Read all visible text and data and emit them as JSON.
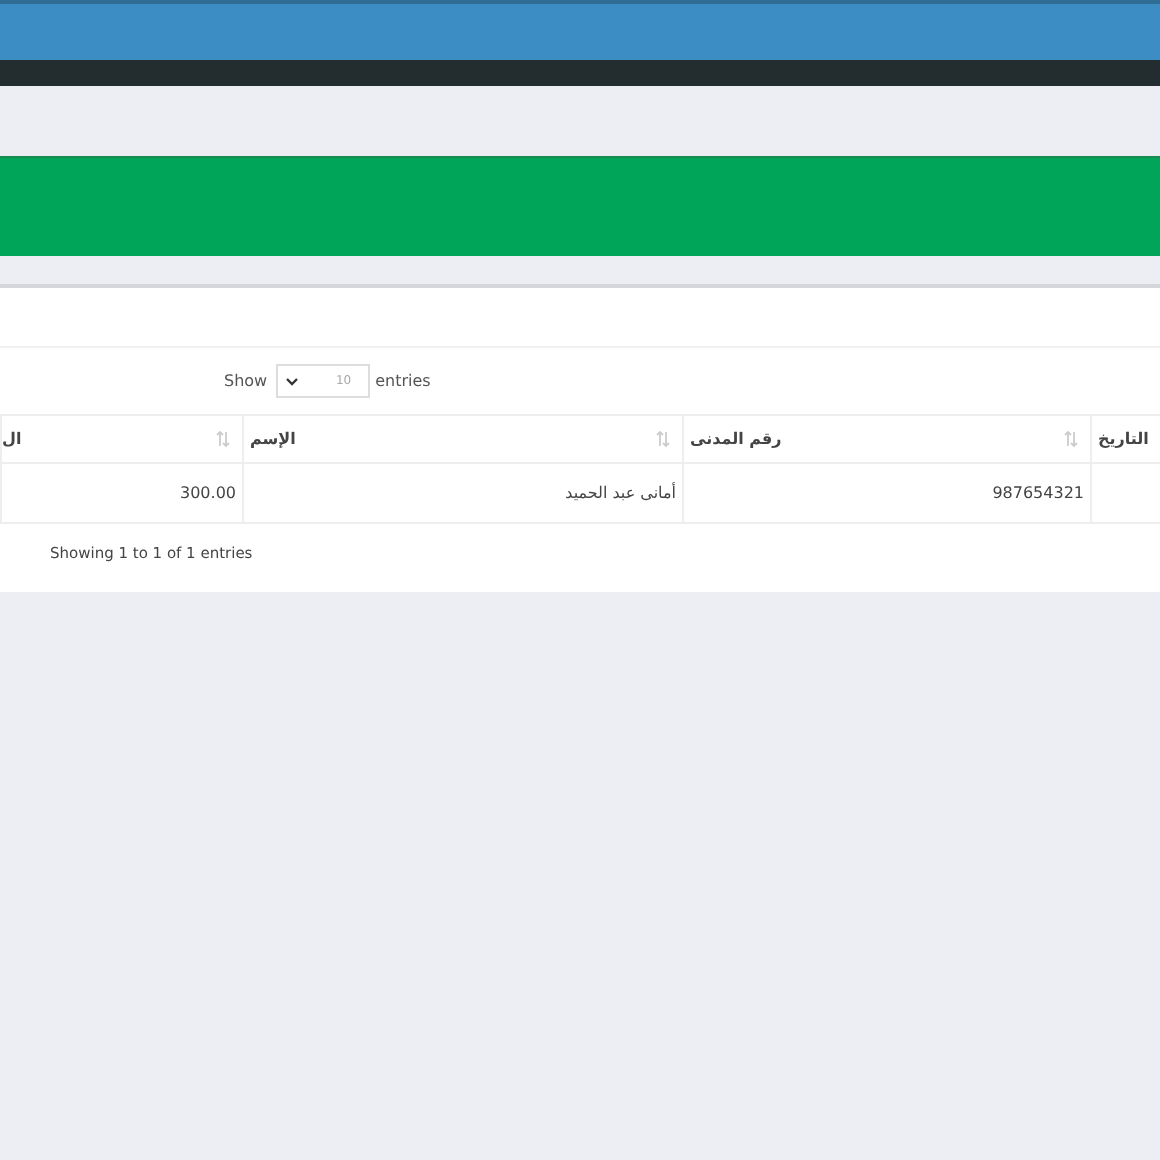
{
  "length_control": {
    "before": "Show",
    "value": "10",
    "after": "entries"
  },
  "table": {
    "columns": [
      {
        "label": "التاريخ",
        "sort_icon": false
      },
      {
        "label": "رقم المدنى",
        "sort_icon": true
      },
      {
        "label": "الإسم",
        "sort_icon": true
      },
      {
        "label": "ال",
        "sort_icon": true
      }
    ],
    "rows": [
      [
        null,
        "987654321",
        "أمانى عبد الحميد",
        "300.00"
      ]
    ]
  },
  "info": "Showing 1 to 1 of 1 entries"
}
